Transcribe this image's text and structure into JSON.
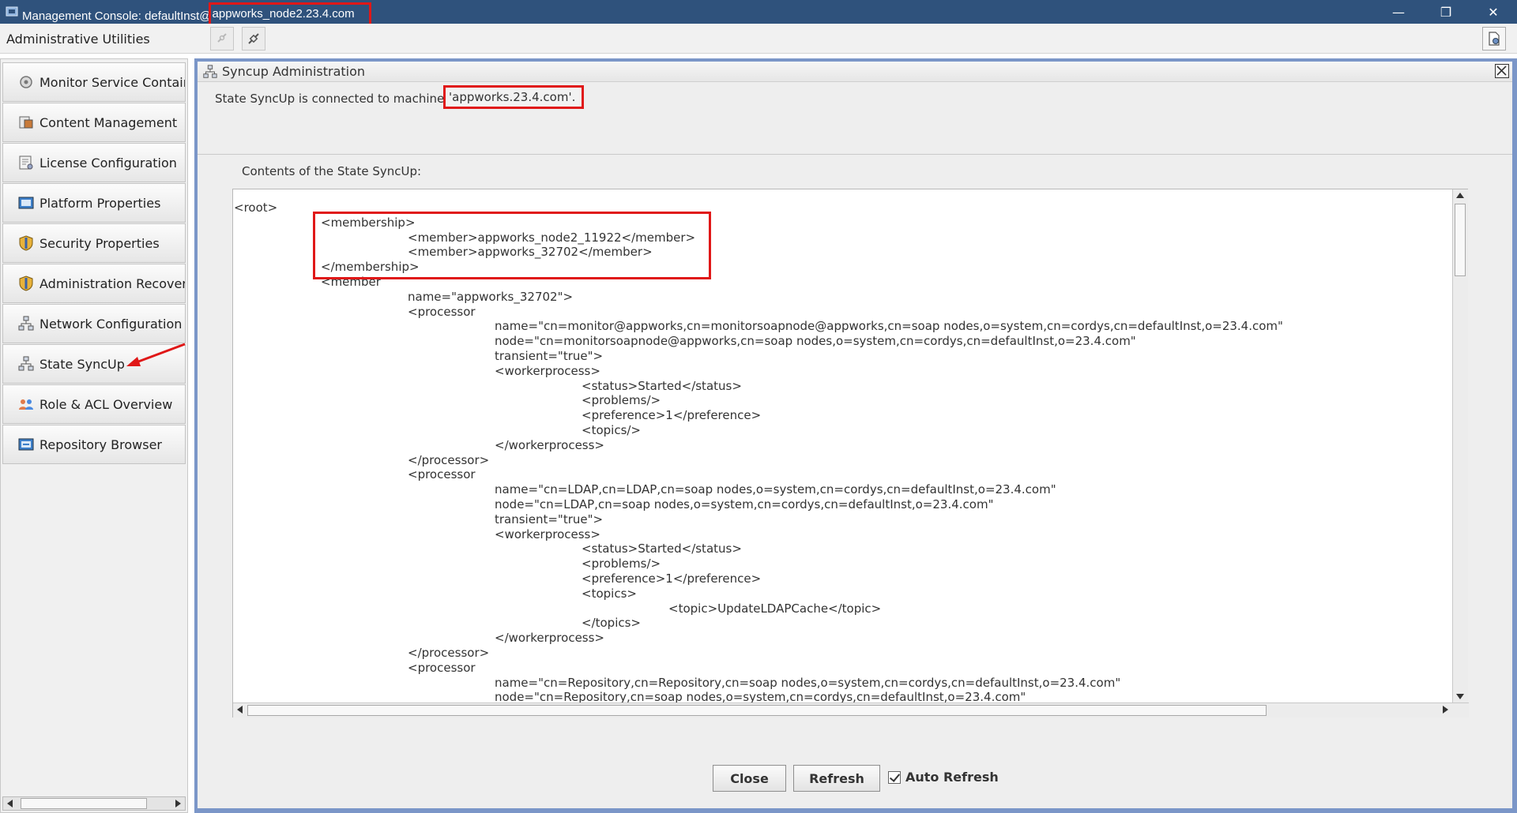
{
  "titlebar": {
    "title_prefix": "Management Console: defaultInst@",
    "title_host": "appworks_node2.23.4.com",
    "minimize": "—",
    "restore": "❐",
    "close": "✕"
  },
  "toolbar": {
    "label": "Administrative Utilities"
  },
  "sidebar": {
    "items": [
      {
        "label": "Monitor Service Container",
        "icon": "monitor-icon"
      },
      {
        "label": "Content Management",
        "icon": "content-icon"
      },
      {
        "label": "License Configuration",
        "icon": "license-icon"
      },
      {
        "label": "Platform Properties",
        "icon": "platform-icon"
      },
      {
        "label": "Security Properties",
        "icon": "shield-icon"
      },
      {
        "label": "Administration Recovery",
        "icon": "shield-icon"
      },
      {
        "label": "Network Configuration",
        "icon": "network-icon"
      },
      {
        "label": "State SyncUp",
        "icon": "network-icon"
      },
      {
        "label": "Role & ACL Overview",
        "icon": "people-icon"
      },
      {
        "label": "Repository Browser",
        "icon": "repository-icon"
      }
    ]
  },
  "panel": {
    "title": "Syncup Administration",
    "status_prefix": "State SyncUp is connected  to machine ",
    "status_machine": "'appworks.23.4.com'.",
    "contents_label": "Contents of the State SyncUp:",
    "xml_lines": [
      {
        "indent": 0,
        "text": "<root>"
      },
      {
        "indent": 1,
        "text": "<membership>"
      },
      {
        "indent": 2,
        "text": "<member>appworks_node2_11922</member>"
      },
      {
        "indent": 2,
        "text": "<member>appworks_32702</member>"
      },
      {
        "indent": 1,
        "text": "</membership>"
      },
      {
        "indent": 1,
        "text": "<member"
      },
      {
        "indent": 2,
        "text": "name=\"appworks_32702\">"
      },
      {
        "indent": 2,
        "text": "<processor"
      },
      {
        "indent": 3,
        "text": "name=\"cn=monitor@appworks,cn=monitorsoapnode@appworks,cn=soap nodes,o=system,cn=cordys,cn=defaultInst,o=23.4.com\""
      },
      {
        "indent": 3,
        "text": "node=\"cn=monitorsoapnode@appworks,cn=soap nodes,o=system,cn=cordys,cn=defaultInst,o=23.4.com\""
      },
      {
        "indent": 3,
        "text": "transient=\"true\">"
      },
      {
        "indent": 3,
        "text": "<workerprocess>"
      },
      {
        "indent": 4,
        "text": "<status>Started</status>"
      },
      {
        "indent": 4,
        "text": "<problems/>"
      },
      {
        "indent": 4,
        "text": "<preference>1</preference>"
      },
      {
        "indent": 4,
        "text": "<topics/>"
      },
      {
        "indent": 3,
        "text": "</workerprocess>"
      },
      {
        "indent": 2,
        "text": "</processor>"
      },
      {
        "indent": 2,
        "text": "<processor"
      },
      {
        "indent": 3,
        "text": "name=\"cn=LDAP,cn=LDAP,cn=soap nodes,o=system,cn=cordys,cn=defaultInst,o=23.4.com\""
      },
      {
        "indent": 3,
        "text": "node=\"cn=LDAP,cn=soap nodes,o=system,cn=cordys,cn=defaultInst,o=23.4.com\""
      },
      {
        "indent": 3,
        "text": "transient=\"true\">"
      },
      {
        "indent": 3,
        "text": "<workerprocess>"
      },
      {
        "indent": 4,
        "text": "<status>Started</status>"
      },
      {
        "indent": 4,
        "text": "<problems/>"
      },
      {
        "indent": 4,
        "text": "<preference>1</preference>"
      },
      {
        "indent": 4,
        "text": "<topics>"
      },
      {
        "indent": 5,
        "text": "<topic>UpdateLDAPCache</topic>"
      },
      {
        "indent": 4,
        "text": "</topics>"
      },
      {
        "indent": 3,
        "text": "</workerprocess>"
      },
      {
        "indent": 2,
        "text": "</processor>"
      },
      {
        "indent": 2,
        "text": "<processor"
      },
      {
        "indent": 3,
        "text": "name=\"cn=Repository,cn=Repository,cn=soap nodes,o=system,cn=cordys,cn=defaultInst,o=23.4.com\""
      },
      {
        "indent": 3,
        "text": "node=\"cn=Repository,cn=soap nodes,o=system,cn=cordys,cn=defaultInst,o=23.4.com\""
      }
    ]
  },
  "buttons": {
    "close_label": "Close",
    "refresh_label": "Refresh",
    "auto_refresh_label": "Auto Refresh",
    "auto_refresh_checked": true
  },
  "colors": {
    "titlebar": "#2f527c",
    "panel_border": "#7b96c8",
    "highlight": "#e01818"
  }
}
